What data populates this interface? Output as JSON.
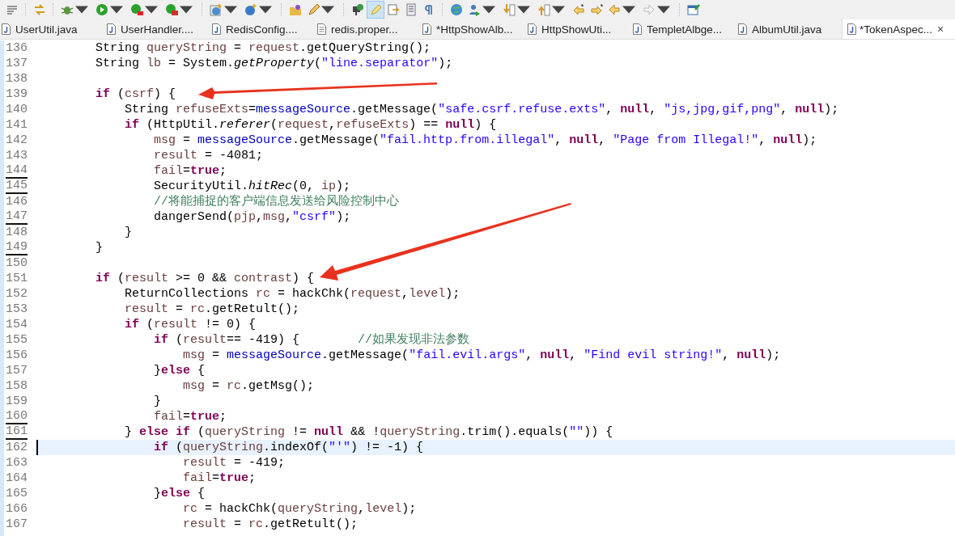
{
  "toolbar": {
    "highlight_toggle": {
      "selected": true
    }
  },
  "tabs": [
    {
      "label": "UserUtil.java",
      "kind": "java",
      "selected": false
    },
    {
      "label": "UserHandler....",
      "kind": "java",
      "selected": false
    },
    {
      "label": "RedisConfig....",
      "kind": "java",
      "selected": false
    },
    {
      "label": "redis.proper...",
      "kind": "text",
      "selected": false
    },
    {
      "label": "*HttpShowAlb...",
      "kind": "java",
      "selected": false
    },
    {
      "label": "HttpShowUti...",
      "kind": "java",
      "selected": false
    },
    {
      "label": "TempletAlbge...",
      "kind": "java",
      "selected": false
    },
    {
      "label": "AlbumUtil.java",
      "kind": "java",
      "selected": false
    },
    {
      "label": "*TokenAspec...",
      "kind": "java",
      "selected": true,
      "close": "×"
    }
  ],
  "lines": [
    {
      "number": "136",
      "changed": false,
      "current": false,
      "tokens": [
        {
          "text": "        String ",
          "kind": "plain"
        },
        {
          "text": "queryString",
          "kind": "local"
        },
        {
          "text": " = ",
          "kind": "plain"
        },
        {
          "text": "request",
          "kind": "local"
        },
        {
          "text": ".getQueryString();",
          "kind": "plain"
        }
      ]
    },
    {
      "number": "137",
      "changed": false,
      "current": false,
      "tokens": [
        {
          "text": "        String ",
          "kind": "plain"
        },
        {
          "text": "lb",
          "kind": "local"
        },
        {
          "text": " = System.",
          "kind": "plain"
        },
        {
          "text": "getProperty",
          "kind": "static"
        },
        {
          "text": "(",
          "kind": "plain"
        },
        {
          "text": "\"line.separator\"",
          "kind": "string"
        },
        {
          "text": ");",
          "kind": "plain"
        }
      ]
    },
    {
      "number": "138",
      "changed": false,
      "current": false
    },
    {
      "number": "139",
      "changed": false,
      "current": false,
      "tokens": [
        {
          "text": "        if",
          "kind": "keyword"
        },
        {
          "text": " (",
          "kind": "plain"
        },
        {
          "text": "csrf",
          "kind": "local"
        },
        {
          "text": ") {",
          "kind": "plain"
        }
      ]
    },
    {
      "number": "140",
      "changed": false,
      "current": false,
      "tokens": [
        {
          "text": "            String ",
          "kind": "plain"
        },
        {
          "text": "refuseExts",
          "kind": "local"
        },
        {
          "text": "=",
          "kind": "plain"
        },
        {
          "text": "messageSource",
          "kind": "field"
        },
        {
          "text": ".getMessage(",
          "kind": "plain"
        },
        {
          "text": "\"safe.csrf.refuse.exts\"",
          "kind": "string"
        },
        {
          "text": ", ",
          "kind": "plain"
        },
        {
          "text": "null",
          "kind": "keyword"
        },
        {
          "text": ", ",
          "kind": "plain"
        },
        {
          "text": "\"js,jpg,gif,png\"",
          "kind": "string"
        },
        {
          "text": ", ",
          "kind": "plain"
        },
        {
          "text": "null",
          "kind": "keyword"
        },
        {
          "text": ");",
          "kind": "plain"
        }
      ]
    },
    {
      "number": "141",
      "changed": false,
      "current": false,
      "tokens": [
        {
          "text": "            if",
          "kind": "keyword"
        },
        {
          "text": " (HttpUtil.",
          "kind": "plain"
        },
        {
          "text": "referer",
          "kind": "static"
        },
        {
          "text": "(",
          "kind": "plain"
        },
        {
          "text": "request",
          "kind": "local"
        },
        {
          "text": ",",
          "kind": "plain"
        },
        {
          "text": "refuseExts",
          "kind": "local"
        },
        {
          "text": ") == ",
          "kind": "plain"
        },
        {
          "text": "null",
          "kind": "keyword"
        },
        {
          "text": ") {",
          "kind": "plain"
        }
      ]
    },
    {
      "number": "142",
      "changed": false,
      "current": false,
      "tokens": [
        {
          "text": "                msg",
          "kind": "local"
        },
        {
          "text": " = ",
          "kind": "plain"
        },
        {
          "text": "messageSource",
          "kind": "field"
        },
        {
          "text": ".getMessage(",
          "kind": "plain"
        },
        {
          "text": "\"fail.http.from.illegal\"",
          "kind": "string"
        },
        {
          "text": ", ",
          "kind": "plain"
        },
        {
          "text": "null",
          "kind": "keyword"
        },
        {
          "text": ", ",
          "kind": "plain"
        },
        {
          "text": "\"Page from Illegal!\"",
          "kind": "string"
        },
        {
          "text": ", ",
          "kind": "plain"
        },
        {
          "text": "null",
          "kind": "keyword"
        },
        {
          "text": ");",
          "kind": "plain"
        }
      ]
    },
    {
      "number": "143",
      "changed": false,
      "current": false,
      "tokens": [
        {
          "text": "                result",
          "kind": "local"
        },
        {
          "text": " = -4081;",
          "kind": "plain"
        }
      ]
    },
    {
      "number": "144",
      "changed": true,
      "current": false,
      "tokens": [
        {
          "text": "                fail",
          "kind": "local"
        },
        {
          "text": "=",
          "kind": "plain"
        },
        {
          "text": "true",
          "kind": "keyword"
        },
        {
          "text": ";",
          "kind": "plain"
        }
      ]
    },
    {
      "number": "145",
      "changed": true,
      "current": false,
      "tokens": [
        {
          "text": "                SecurityUtil.",
          "kind": "plain"
        },
        {
          "text": "hitRec",
          "kind": "static"
        },
        {
          "text": "(0, ",
          "kind": "plain"
        },
        {
          "text": "ip",
          "kind": "local"
        },
        {
          "text": ");",
          "kind": "plain"
        }
      ]
    },
    {
      "number": "146",
      "changed": false,
      "current": false,
      "tokens": [
        {
          "text": "                //将能捕捉的客户端信息发送给风险控制中心",
          "kind": "comment"
        }
      ]
    },
    {
      "number": "147",
      "changed": true,
      "current": false,
      "tokens": [
        {
          "text": "                dangerSend(",
          "kind": "plain"
        },
        {
          "text": "pjp",
          "kind": "local"
        },
        {
          "text": ",",
          "kind": "plain"
        },
        {
          "text": "msg",
          "kind": "local"
        },
        {
          "text": ",",
          "kind": "plain"
        },
        {
          "text": "\"csrf\"",
          "kind": "string"
        },
        {
          "text": ");",
          "kind": "plain"
        }
      ]
    },
    {
      "number": "148",
      "changed": false,
      "current": false,
      "tokens": [
        {
          "text": "            }",
          "kind": "plain"
        }
      ]
    },
    {
      "number": "149",
      "changed": true,
      "current": false,
      "tokens": [
        {
          "text": "        }",
          "kind": "plain"
        }
      ]
    },
    {
      "number": "150",
      "changed": false,
      "current": false
    },
    {
      "number": "151",
      "changed": false,
      "current": false,
      "tokens": [
        {
          "text": "        if",
          "kind": "keyword"
        },
        {
          "text": " (",
          "kind": "plain"
        },
        {
          "text": "result",
          "kind": "local"
        },
        {
          "text": " >= 0 && ",
          "kind": "plain"
        },
        {
          "text": "contrast",
          "kind": "local"
        },
        {
          "text": ") {",
          "kind": "plain"
        }
      ]
    },
    {
      "number": "152",
      "changed": false,
      "current": false,
      "tokens": [
        {
          "text": "            ReturnCollections ",
          "kind": "plain"
        },
        {
          "text": "rc",
          "kind": "local"
        },
        {
          "text": " = hackChk(",
          "kind": "plain"
        },
        {
          "text": "request",
          "kind": "local"
        },
        {
          "text": ",",
          "kind": "plain"
        },
        {
          "text": "level",
          "kind": "local"
        },
        {
          "text": ");",
          "kind": "plain"
        }
      ]
    },
    {
      "number": "153",
      "changed": false,
      "current": false,
      "tokens": [
        {
          "text": "            result",
          "kind": "local"
        },
        {
          "text": " = ",
          "kind": "plain"
        },
        {
          "text": "rc",
          "kind": "local"
        },
        {
          "text": ".getRetult();",
          "kind": "plain"
        }
      ]
    },
    {
      "number": "154",
      "changed": false,
      "current": false,
      "tokens": [
        {
          "text": "            if",
          "kind": "keyword"
        },
        {
          "text": " (",
          "kind": "plain"
        },
        {
          "text": "result",
          "kind": "local"
        },
        {
          "text": " != 0) {",
          "kind": "plain"
        }
      ]
    },
    {
      "number": "155",
      "changed": false,
      "current": false,
      "tokens": [
        {
          "text": "                if",
          "kind": "keyword"
        },
        {
          "text": " (",
          "kind": "plain"
        },
        {
          "text": "result",
          "kind": "local"
        },
        {
          "text": "== -419) {        ",
          "kind": "plain"
        },
        {
          "text": "//如果发现非法参数",
          "kind": "comment"
        }
      ]
    },
    {
      "number": "156",
      "changed": false,
      "current": false,
      "tokens": [
        {
          "text": "                    msg",
          "kind": "local"
        },
        {
          "text": " = ",
          "kind": "plain"
        },
        {
          "text": "messageSource",
          "kind": "field"
        },
        {
          "text": ".getMessage(",
          "kind": "plain"
        },
        {
          "text": "\"fail.evil.args\"",
          "kind": "string"
        },
        {
          "text": ", ",
          "kind": "plain"
        },
        {
          "text": "null",
          "kind": "keyword"
        },
        {
          "text": ", ",
          "kind": "plain"
        },
        {
          "text": "\"Find evil string!\"",
          "kind": "string"
        },
        {
          "text": ", ",
          "kind": "plain"
        },
        {
          "text": "null",
          "kind": "keyword"
        },
        {
          "text": ");",
          "kind": "plain"
        }
      ]
    },
    {
      "number": "157",
      "changed": false,
      "current": false,
      "tokens": [
        {
          "text": "                }",
          "kind": "plain"
        },
        {
          "text": "else",
          "kind": "keyword"
        },
        {
          "text": " {",
          "kind": "plain"
        }
      ]
    },
    {
      "number": "158",
      "changed": false,
      "current": false,
      "tokens": [
        {
          "text": "                    msg",
          "kind": "local"
        },
        {
          "text": " = ",
          "kind": "plain"
        },
        {
          "text": "rc",
          "kind": "local"
        },
        {
          "text": ".getMsg();",
          "kind": "plain"
        }
      ]
    },
    {
      "number": "159",
      "changed": false,
      "current": false,
      "tokens": [
        {
          "text": "                }",
          "kind": "plain"
        }
      ]
    },
    {
      "number": "160",
      "changed": true,
      "current": false,
      "tokens": [
        {
          "text": "                fail",
          "kind": "local"
        },
        {
          "text": "=",
          "kind": "plain"
        },
        {
          "text": "true",
          "kind": "keyword"
        },
        {
          "text": ";",
          "kind": "plain"
        }
      ]
    },
    {
      "number": "161",
      "changed": true,
      "current": false,
      "tokens": [
        {
          "text": "            } ",
          "kind": "plain"
        },
        {
          "text": "else if",
          "kind": "keyword"
        },
        {
          "text": " (",
          "kind": "plain"
        },
        {
          "text": "queryString",
          "kind": "local"
        },
        {
          "text": " != ",
          "kind": "plain"
        },
        {
          "text": "null",
          "kind": "keyword"
        },
        {
          "text": " && !",
          "kind": "plain"
        },
        {
          "text": "queryString",
          "kind": "local"
        },
        {
          "text": ".trim().equals(",
          "kind": "plain"
        },
        {
          "text": "\"\"",
          "kind": "string"
        },
        {
          "text": ")) {",
          "kind": "plain"
        }
      ]
    },
    {
      "number": "162",
      "changed": false,
      "current": true,
      "tokens": [
        {
          "text": "                if",
          "kind": "keyword"
        },
        {
          "text": " (",
          "kind": "plain"
        },
        {
          "text": "queryString",
          "kind": "local"
        },
        {
          "text": ".indexOf(",
          "kind": "plain"
        },
        {
          "text": "\"'\"",
          "kind": "string"
        },
        {
          "text": ") != -1) {",
          "kind": "plain"
        }
      ]
    },
    {
      "number": "163",
      "changed": false,
      "current": false,
      "tokens": [
        {
          "text": "                    result",
          "kind": "local"
        },
        {
          "text": " = -419;",
          "kind": "plain"
        }
      ]
    },
    {
      "number": "164",
      "changed": false,
      "current": false,
      "tokens": [
        {
          "text": "                    fail",
          "kind": "local"
        },
        {
          "text": "=",
          "kind": "plain"
        },
        {
          "text": "true",
          "kind": "keyword"
        },
        {
          "text": ";",
          "kind": "plain"
        }
      ]
    },
    {
      "number": "165",
      "changed": false,
      "current": false,
      "tokens": [
        {
          "text": "                }",
          "kind": "plain"
        },
        {
          "text": "else",
          "kind": "keyword"
        },
        {
          "text": " {",
          "kind": "plain"
        }
      ]
    },
    {
      "number": "166",
      "changed": false,
      "current": false,
      "tokens": [
        {
          "text": "                    rc",
          "kind": "local"
        },
        {
          "text": " = hackChk(",
          "kind": "plain"
        },
        {
          "text": "queryString",
          "kind": "local"
        },
        {
          "text": ",",
          "kind": "plain"
        },
        {
          "text": "level",
          "kind": "local"
        },
        {
          "text": ");",
          "kind": "plain"
        }
      ]
    },
    {
      "number": "167",
      "changed": false,
      "current": false,
      "tokens": [
        {
          "text": "                    result",
          "kind": "local"
        },
        {
          "text": " = ",
          "kind": "plain"
        },
        {
          "text": "rc",
          "kind": "local"
        },
        {
          "text": ".getRetult();",
          "kind": "plain"
        }
      ]
    }
  ]
}
